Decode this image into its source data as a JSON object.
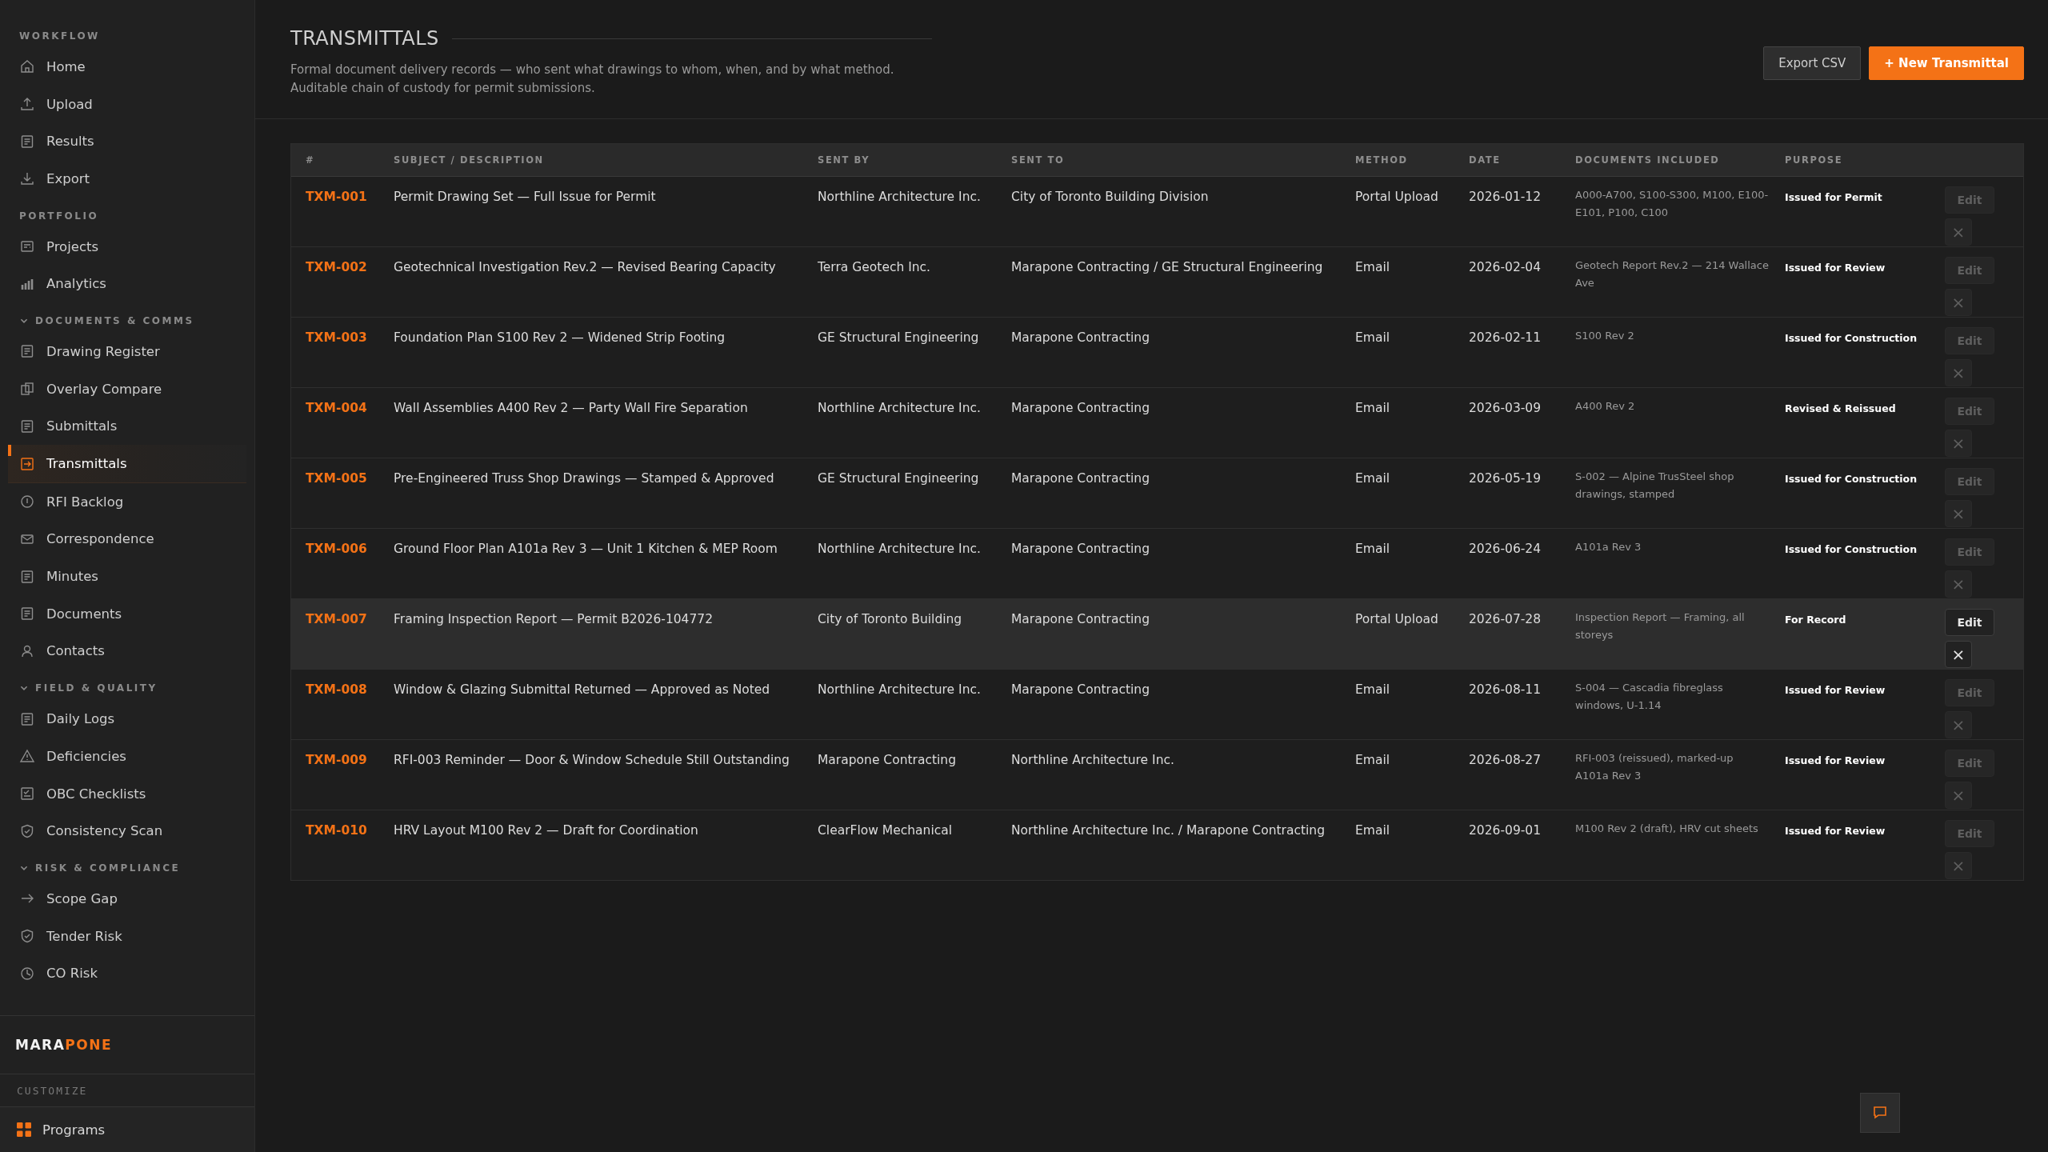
{
  "sidebar": {
    "sections": [
      {
        "title": "WORKFLOW",
        "items": [
          {
            "label": "Home",
            "selected": false
          },
          {
            "label": "Upload",
            "selected": false
          },
          {
            "label": "Results",
            "selected": false
          },
          {
            "label": "Export",
            "selected": false
          }
        ]
      },
      {
        "title": "PORTFOLIO",
        "items": [
          {
            "label": "Projects",
            "selected": false
          },
          {
            "label": "Analytics",
            "selected": false
          }
        ]
      },
      {
        "title": "DOCUMENTS & COMMS",
        "expanded": true,
        "items": [
          {
            "label": "Drawing Register",
            "selected": false
          },
          {
            "label": "Overlay Compare",
            "selected": false
          },
          {
            "label": "Submittals",
            "selected": false
          },
          {
            "label": "Transmittals",
            "selected": true
          },
          {
            "label": "RFI Backlog",
            "selected": false
          },
          {
            "label": "Correspondence",
            "selected": false
          },
          {
            "label": "Minutes",
            "selected": false
          },
          {
            "label": "Documents",
            "selected": false
          },
          {
            "label": "Contacts",
            "selected": false
          }
        ]
      },
      {
        "title": "FIELD & QUALITY",
        "expanded": true,
        "items": [
          {
            "label": "Daily Logs",
            "selected": false
          },
          {
            "label": "Deficiencies",
            "selected": false
          },
          {
            "label": "OBC Checklists",
            "selected": false
          },
          {
            "label": "Consistency Scan",
            "selected": false
          }
        ]
      },
      {
        "title": "RISK & COMPLIANCE",
        "expanded": true,
        "items": [
          {
            "label": "Scope Gap",
            "selected": false
          },
          {
            "label": "Tender Risk",
            "selected": false
          },
          {
            "label": "CO Risk",
            "selected": false
          }
        ]
      }
    ],
    "brand": [
      "MARA",
      "PONE"
    ],
    "customize_label": "CUSTOMIZE",
    "programs": "Programs"
  },
  "header": {
    "title": "TRANSMITTALS",
    "description": "Formal document delivery records — who sent what drawings to whom, when, and by what method. Auditable chain of custody for permit submissions.",
    "buttons": [
      {
        "label": "Export CSV",
        "kind": "secondary"
      },
      {
        "label": "+ New Transmittal",
        "kind": "primary"
      }
    ]
  },
  "table": {
    "columns": [
      "#",
      "SUBJECT / DESCRIPTION",
      "SENT BY",
      "SENT TO",
      "METHOD",
      "DATE",
      "DOCUMENTS INCLUDED",
      "PURPOSE"
    ],
    "rows": [
      {
        "id": "TXM-001",
        "subject": "Permit Drawing Set — Full Issue for Permit",
        "sent_by": "Northline Architecture Inc.",
        "sent_to": "City of Toronto Building Division",
        "method": "Portal Upload",
        "date": "2026-01-12",
        "documents": "A000-A700, S100-S300, M100, E100-E101, P100, C100",
        "purpose": "Issued for Permit",
        "edit": "Edit",
        "delete": "×",
        "highlighted": false
      },
      {
        "id": "TXM-002",
        "subject": "Geotechnical Investigation Rev.2 — Revised Bearing Capacity",
        "sent_by": "Terra Geotech Inc.",
        "sent_to": "Marapone Contracting / GE Structural Engineering",
        "method": "Email",
        "date": "2026-02-04",
        "documents": "Geotech Report Rev.2 — 214 Wallace Ave",
        "purpose": "Issued for Review",
        "edit": "Edit",
        "delete": "×",
        "highlighted": false
      },
      {
        "id": "TXM-003",
        "subject": "Foundation Plan S100 Rev 2 — Widened Strip Footing",
        "sent_by": "GE Structural Engineering",
        "sent_to": "Marapone Contracting",
        "method": "Email",
        "date": "2026-02-11",
        "documents": "S100 Rev 2",
        "purpose": "Issued for Construction",
        "edit": "Edit",
        "delete": "×",
        "highlighted": false
      },
      {
        "id": "TXM-004",
        "subject": "Wall Assemblies A400 Rev 2 — Party Wall Fire Separation",
        "sent_by": "Northline Architecture Inc.",
        "sent_to": "Marapone Contracting",
        "method": "Email",
        "date": "2026-03-09",
        "documents": "A400 Rev 2",
        "purpose": "Revised & Reissued",
        "edit": "Edit",
        "delete": "×",
        "highlighted": false
      },
      {
        "id": "TXM-005",
        "subject": "Pre-Engineered Truss Shop Drawings — Stamped & Approved",
        "sent_by": "GE Structural Engineering",
        "sent_to": "Marapone Contracting",
        "method": "Email",
        "date": "2026-05-19",
        "documents": "S-002 — Alpine TrusSteel shop drawings, stamped",
        "purpose": "Issued for Construction",
        "edit": "Edit",
        "delete": "×",
        "highlighted": false
      },
      {
        "id": "TXM-006",
        "subject": "Ground Floor Plan A101a Rev 3 — Unit 1 Kitchen & MEP Room",
        "sent_by": "Northline Architecture Inc.",
        "sent_to": "Marapone Contracting",
        "method": "Email",
        "date": "2026-06-24",
        "documents": "A101a Rev 3",
        "purpose": "Issued for Construction",
        "edit": "Edit",
        "delete": "×",
        "highlighted": false
      },
      {
        "id": "TXM-007",
        "subject": "Framing Inspection Report — Permit B2026-104772",
        "sent_by": "City of Toronto Building",
        "sent_to": "Marapone Contracting",
        "method": "Portal Upload",
        "date": "2026-07-28",
        "documents": "Inspection Report — Framing, all storeys",
        "purpose": "For Record",
        "edit": "Edit",
        "delete": "×",
        "highlighted": true
      },
      {
        "id": "TXM-008",
        "subject": "Window & Glazing Submittal Returned — Approved as Noted",
        "sent_by": "Northline Architecture Inc.",
        "sent_to": "Marapone Contracting",
        "method": "Email",
        "date": "2026-08-11",
        "documents": "S-004 — Cascadia fibreglass windows, U-1.14",
        "purpose": "Issued for Review",
        "edit": "Edit",
        "delete": "×",
        "highlighted": false
      },
      {
        "id": "TXM-009",
        "subject": "RFI-003 Reminder — Door & Window Schedule Still Outstanding",
        "sent_by": "Marapone Contracting",
        "sent_to": "Northline Architecture Inc.",
        "method": "Email",
        "date": "2026-08-27",
        "documents": "RFI-003 (reissued), marked-up A101a Rev 3",
        "purpose": "Issued for Review",
        "edit": "Edit",
        "delete": "×",
        "highlighted": false
      },
      {
        "id": "TXM-010",
        "subject": "HRV Layout M100 Rev 2 — Draft for Coordination",
        "sent_by": "ClearFlow Mechanical",
        "sent_to": "Northline Architecture Inc. / Marapone Contracting",
        "method": "Email",
        "date": "2026-09-01",
        "documents": "M100 Rev 2 (draft), HRV cut sheets",
        "purpose": "Issued for Review",
        "edit": "Edit",
        "delete": "×",
        "highlighted": false
      }
    ]
  }
}
